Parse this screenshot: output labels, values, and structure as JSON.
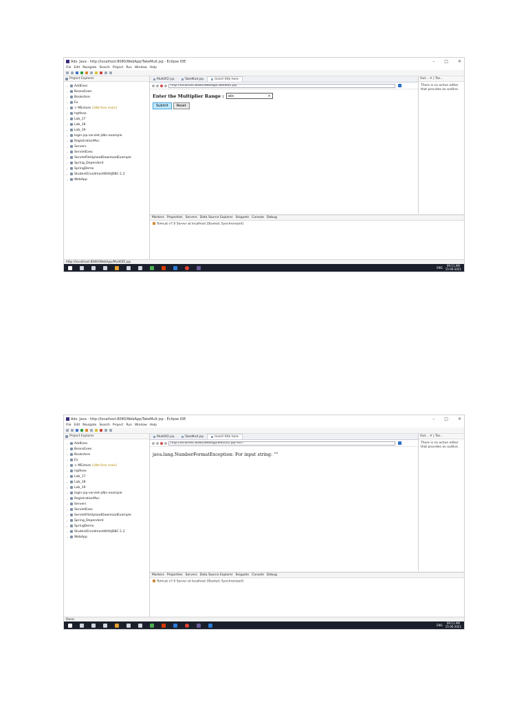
{
  "window": {
    "title1": "Adv. Java - http://localhost:8080/WebApp/TakeMult.jsp - Eclipse IDE",
    "title2": "Adv. Java - http://localhost:8080/WebApp/TakeMult.jsp - Eclipse IDE",
    "minimize": "–",
    "maximize": "□",
    "close": "✕"
  },
  "menu": [
    "File",
    "Edit",
    "Navigate",
    "Search",
    "Project",
    "Run",
    "Window",
    "Help"
  ],
  "explorer": {
    "title": "Project Explorer",
    "items": [
      {
        "label": "AddExec",
        "deco": ""
      },
      {
        "label": "BeansExee",
        "deco": ""
      },
      {
        "label": "Bookstore",
        "deco": ""
      },
      {
        "label": "Ex",
        "deco": ""
      },
      {
        "label": "> MExtore",
        "deco": "[idbt.fore main]"
      },
      {
        "label": "hqtfeee",
        "deco": ""
      },
      {
        "label": "Lab_17",
        "deco": ""
      },
      {
        "label": "Lab_18",
        "deco": ""
      },
      {
        "label": "Lab_19",
        "deco": ""
      },
      {
        "label": "login-jsp-servlet-jdbc-example",
        "deco": ""
      },
      {
        "label": "RegistrationMvc",
        "deco": ""
      },
      {
        "label": "Servers",
        "deco": ""
      },
      {
        "label": "ServletExec",
        "deco": ""
      },
      {
        "label": "ServletFileUploadDownloadExample",
        "deco": ""
      },
      {
        "label": "Spring_Dependent",
        "deco": ""
      },
      {
        "label": "SpringDemo",
        "deco": ""
      },
      {
        "label": "StudentEnrollmentWithJDBC-1.2",
        "deco": ""
      },
      {
        "label": "WebApp",
        "deco": ""
      }
    ]
  },
  "editor": {
    "tabs": [
      {
        "label": "MultOf2.jsp"
      },
      {
        "label": "TakeMult.jsp"
      },
      {
        "label": "Insert title here"
      }
    ],
    "shot1": {
      "url": "http://localhost:8080/WebApp/TakeMult.jsp",
      "form_label": "Enter the Multiplier Range :",
      "input_value": "abc",
      "clear_glyph": "×",
      "submit_label": "Submit",
      "reset_label": "Reset",
      "status": "http://localhost:8080/WebApp/MultOf2.jsp"
    },
    "shot2": {
      "url": "http://localhost:8080/WebApp/MultOf2.jsp?no=",
      "error": "java.lang.NumberFormatException: For input string: \"\"",
      "status": "Done"
    }
  },
  "outline": {
    "tabs": "Out... ✕ | Tas...",
    "message": "There is no active editor that provides an outline."
  },
  "bottom": {
    "tabs": [
      "Markers",
      "Properties",
      "Servers",
      "Data Source Explorer",
      "Snippets",
      "Console",
      "Debug"
    ],
    "server": "Tomcat v7.0 Server at localhost  [Started, Synchronized]"
  },
  "taskbar": {
    "lang": "ENG",
    "time": "09:11 AM",
    "date": "15-06-2021"
  }
}
